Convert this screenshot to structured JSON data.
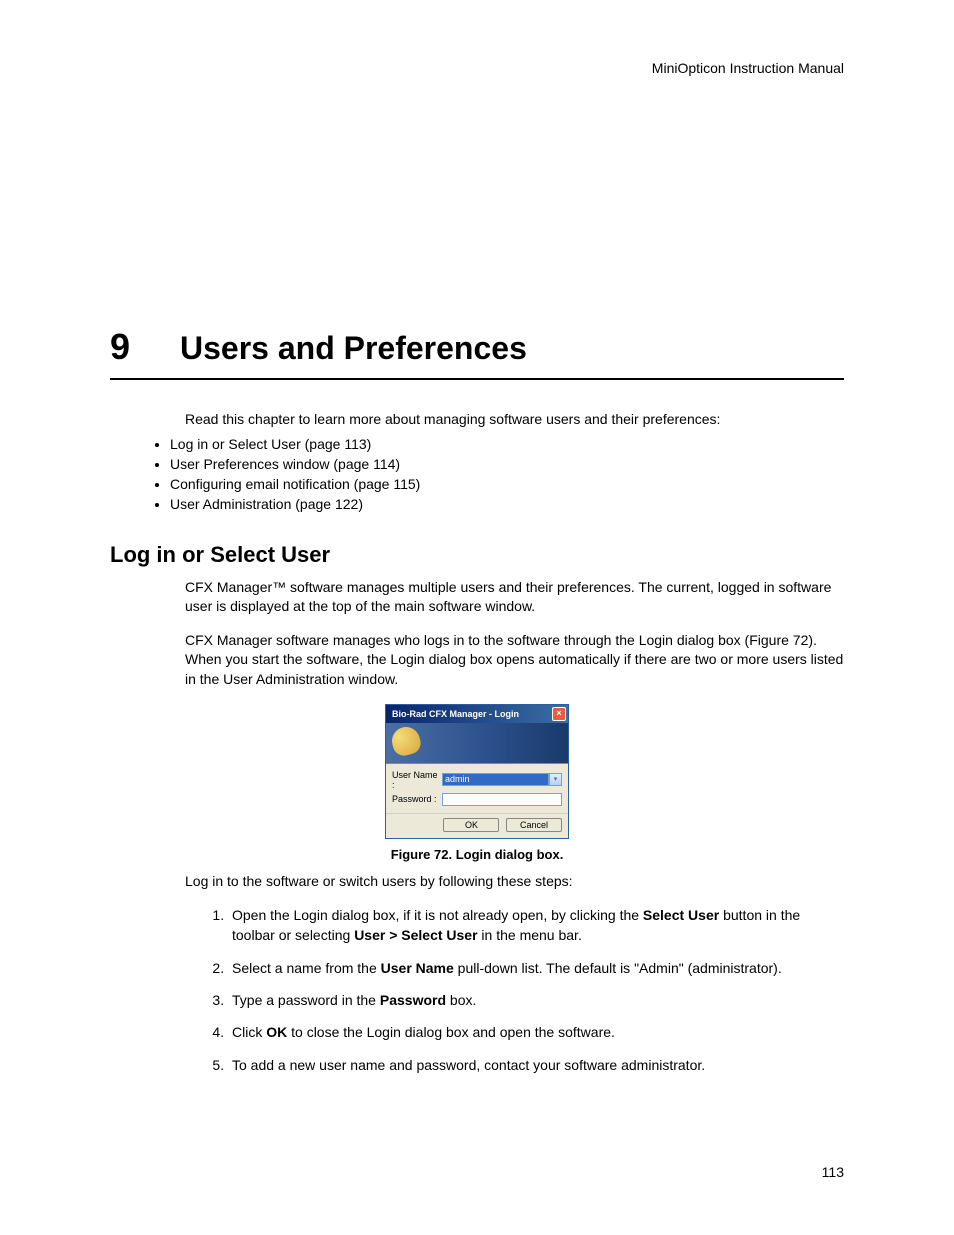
{
  "header": "MiniOpticon Instruction Manual",
  "chapter": {
    "number": "9",
    "title": "Users and Preferences"
  },
  "intro_text": "Read this chapter to learn more about managing software users and their preferences:",
  "bullets": [
    "Log in or Select User (page 113)",
    "User Preferences window (page 114)",
    "Configuring email notification (page 115)",
    "User Administration (page 122)"
  ],
  "section_title": "Log in or Select User",
  "para1": "CFX Manager™ software manages multiple users and their preferences. The current, logged in software user is displayed at the top of the main software window.",
  "para2": "CFX Manager software manages who logs in to the software through the Login dialog box (Figure 72). When you start the software, the Login dialog box opens automatically if there are two or more users listed in the User Administration window.",
  "dialog": {
    "title": "Bio-Rad CFX Manager - Login",
    "username_label": "User Name :",
    "username_value": "admin",
    "password_label": "Password :",
    "ok": "OK",
    "cancel": "Cancel"
  },
  "figure_caption": "Figure 72. Login dialog box.",
  "para3": "Log in to the software or switch users by following these steps:",
  "steps": {
    "s1a": "Open the Login dialog box, if it is not already open, by clicking the ",
    "s1b": "Select User",
    "s1c": " button in the toolbar or selecting ",
    "s1d": "User > Select User",
    "s1e": " in the menu bar.",
    "s2a": "Select a name from the ",
    "s2b": "User Name",
    "s2c": " pull-down list. The default is \"Admin\" (administrator).",
    "s3a": "Type a password in the ",
    "s3b": "Password",
    "s3c": " box.",
    "s4a": "Click ",
    "s4b": "OK",
    "s4c": " to close the Login dialog box and open the software.",
    "s5": "To add a new user name and password, contact your software administrator."
  },
  "page_number": "113"
}
